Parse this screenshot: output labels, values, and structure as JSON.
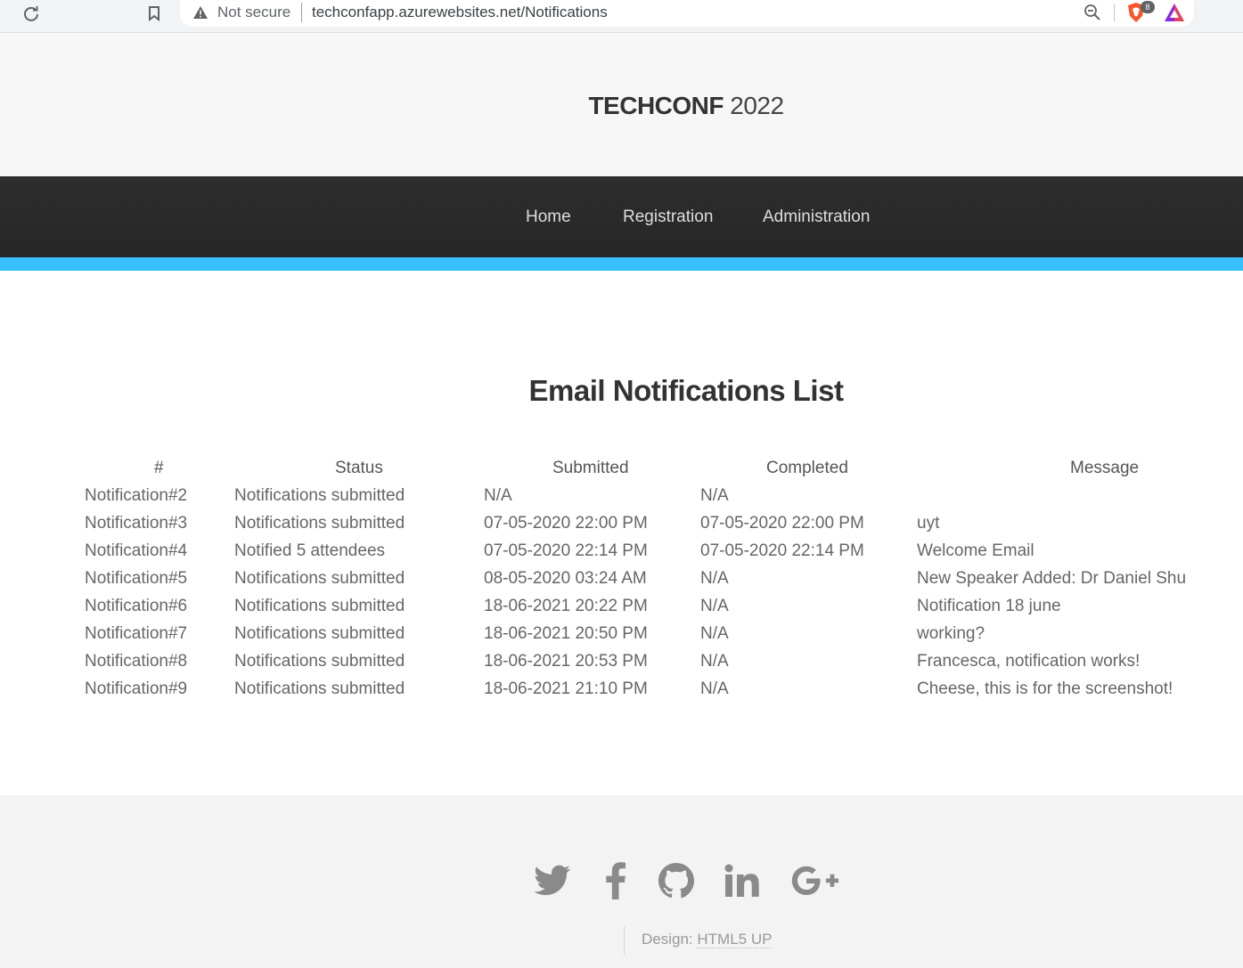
{
  "browser": {
    "security_label": "Not secure",
    "url": "techconfapp.azurewebsites.net/Notifications",
    "extension_badge": "8"
  },
  "header": {
    "brand": "TECHCONF",
    "year": "2022"
  },
  "nav": {
    "items": [
      {
        "label": "Home"
      },
      {
        "label": "Registration"
      },
      {
        "label": "Administration"
      }
    ]
  },
  "main": {
    "heading": "Email Notifications List",
    "columns": [
      "#",
      "Status",
      "Submitted",
      "Completed",
      "Message"
    ],
    "rows": [
      {
        "id": "Notification#2",
        "status": "Notifications submitted",
        "submitted": "N/A",
        "completed": "N/A",
        "message": ""
      },
      {
        "id": "Notification#3",
        "status": "Notifications submitted",
        "submitted": "07-05-2020 22:00 PM",
        "completed": "07-05-2020 22:00 PM",
        "message": "uyt"
      },
      {
        "id": "Notification#4",
        "status": "Notified 5 attendees",
        "submitted": "07-05-2020 22:14 PM",
        "completed": "07-05-2020 22:14 PM",
        "message": "Welcome Email"
      },
      {
        "id": "Notification#5",
        "status": "Notifications submitted",
        "submitted": "08-05-2020 03:24 AM",
        "completed": "N/A",
        "message": "New Speaker Added: Dr Daniel Shu"
      },
      {
        "id": "Notification#6",
        "status": "Notifications submitted",
        "submitted": "18-06-2021 20:22 PM",
        "completed": "N/A",
        "message": "Notification 18 june"
      },
      {
        "id": "Notification#7",
        "status": "Notifications submitted",
        "submitted": "18-06-2021 20:50 PM",
        "completed": "N/A",
        "message": "working?"
      },
      {
        "id": "Notification#8",
        "status": "Notifications submitted",
        "submitted": "18-06-2021 20:53 PM",
        "completed": "N/A",
        "message": "Francesca, notification works!"
      },
      {
        "id": "Notification#9",
        "status": "Notifications submitted",
        "submitted": "18-06-2021 21:10 PM",
        "completed": "N/A",
        "message": "Cheese, this is for the screenshot!"
      }
    ]
  },
  "footer": {
    "social_icons": [
      "twitter-icon",
      "facebook-icon",
      "github-icon",
      "linkedin-icon",
      "google-plus-icon"
    ],
    "credit_prefix": "Design:",
    "credit_link": "HTML5 UP"
  },
  "colors": {
    "accent": "#37c0fb",
    "nav_bg": "#2a2a2a",
    "header_bg": "#f7f7f7",
    "footer_bg": "#f3f3f3"
  }
}
